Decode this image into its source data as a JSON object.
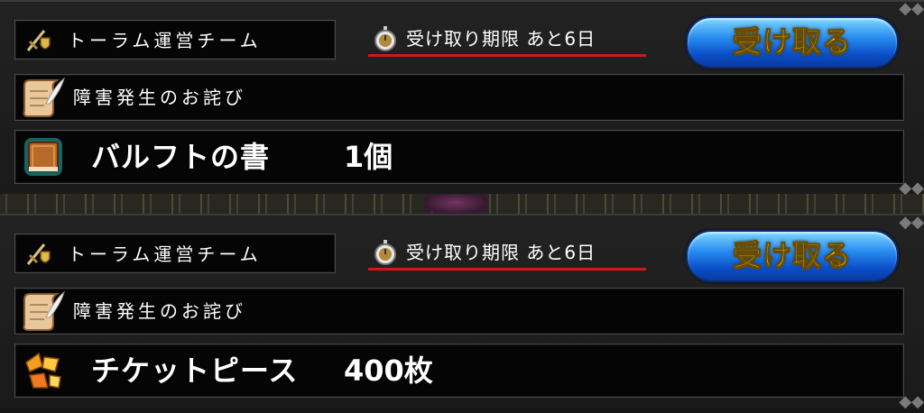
{
  "mails": [
    {
      "sender": "トーラム運営チーム",
      "deadline": "受け取り期限  あと6日",
      "receive_label": "受け取る",
      "subject": "障害発生のお詫び",
      "item_name": "バルフトの書",
      "item_qty": "1個",
      "item_icon": "book-icon"
    },
    {
      "sender": "トーラム運営チーム",
      "deadline": "受け取り期限  あと6日",
      "receive_label": "受け取る",
      "subject": "障害発生のお詫び",
      "item_name": "チケットピース",
      "item_qty": "400枚",
      "item_icon": "ticket-piece-icon"
    }
  ],
  "colors": {
    "button_text": "#ffe81a",
    "button_blue": "#2a8cf0",
    "deadline_underline": "#d01818"
  }
}
